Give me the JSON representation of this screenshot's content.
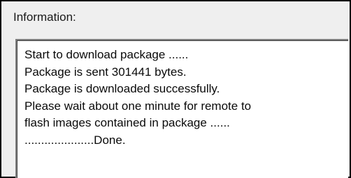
{
  "panel": {
    "label": "Information:"
  },
  "log": {
    "lines": [
      "Start to download package ......",
      "Package is sent 301441 bytes.",
      "Package is downloaded successfully.",
      "Please wait about one minute for remote to",
      "flash images contained in package ......",
      ".....................Done."
    ]
  }
}
